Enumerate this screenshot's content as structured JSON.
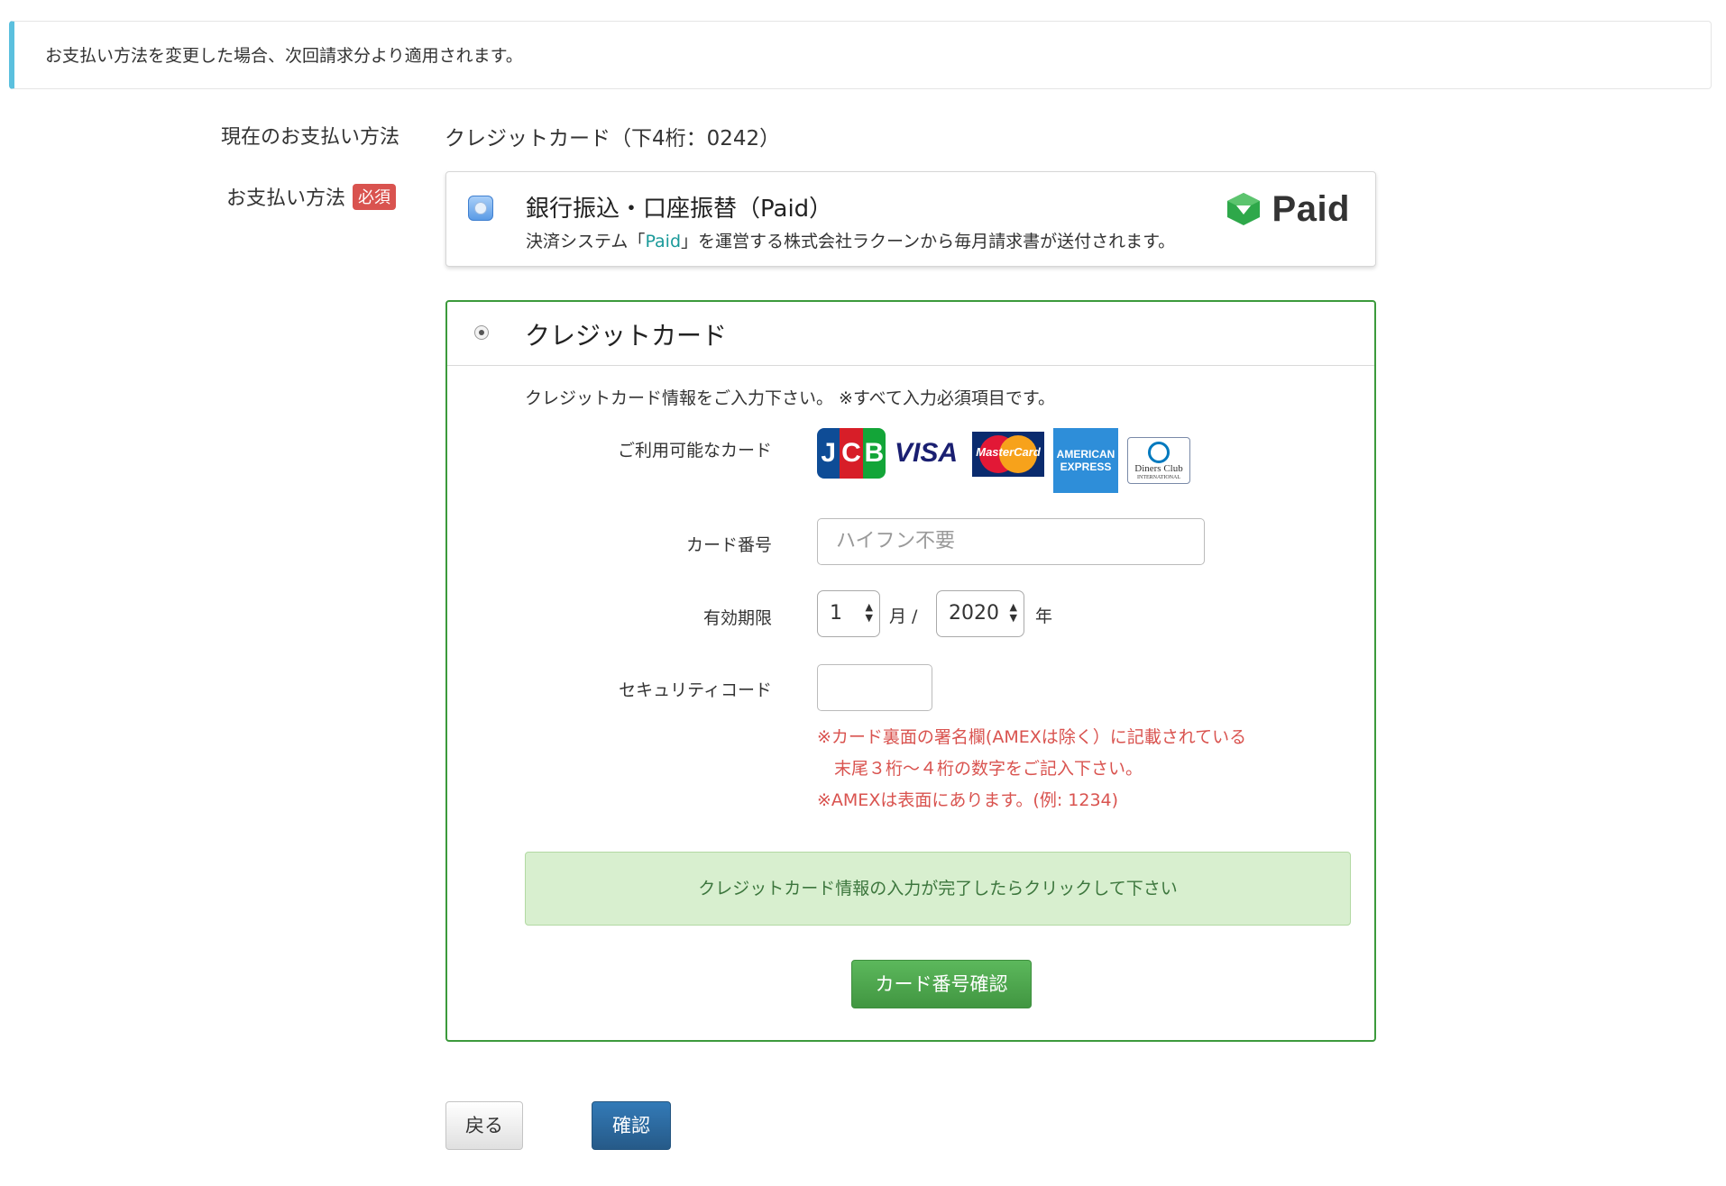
{
  "notice": {
    "text": "お支払い方法を変更した場合、次回請求分より適用されます。"
  },
  "current_payment": {
    "label": "現在のお支払い方法",
    "value": "クレジットカード（下4桁：0242）"
  },
  "payment_method": {
    "label": "お支払い方法",
    "required_badge": "必須"
  },
  "bank_option": {
    "title": "銀行振込・口座振替（Paid）",
    "desc_before": "決済システム「",
    "desc_link": "Paid",
    "desc_after": "」を運営する株式会社ラクーンから毎月請求書が送付されます。",
    "logo_text": "Paid",
    "logo_color": "#2ea84a"
  },
  "credit_option": {
    "title": "クレジットカード",
    "intro": "クレジットカード情報をご入力下さい。 ※すべて入力必須項目です。",
    "available_cards_label": "ご利用可能なカード",
    "cards": {
      "jcb": [
        "J",
        "C",
        "B"
      ],
      "visa": "VISA",
      "mastercard": "MasterCard",
      "amex": [
        "AMERICAN",
        "EXPRESS"
      ],
      "diners": [
        "Diners Club",
        "INTERNATIONAL"
      ]
    },
    "card_number": {
      "label": "カード番号",
      "placeholder": "ハイフン不要"
    },
    "expiry": {
      "label": "有効期限",
      "month": "1",
      "month_unit": "月 /",
      "year": "2020",
      "year_unit": "年"
    },
    "security_code": {
      "label": "セキュリティコード",
      "value": "",
      "notes": [
        "※カード裏面の署名欄(AMEXは除く）に記載されている",
        "　末尾３桁〜４桁の数字をご記入下さい。",
        "※AMEXは表面にあります。(例: 1234)"
      ]
    },
    "alert": "クレジットカード情報の入力が完了したらクリックして下さい",
    "confirm_button": "カード番号確認"
  },
  "footer": {
    "back_button": "戻る",
    "submit_button": "確認"
  },
  "colors": {
    "accent_info": "#5bc0de",
    "success": "#5cb85c",
    "primary": "#337ab7",
    "danger": "#d9534f"
  }
}
